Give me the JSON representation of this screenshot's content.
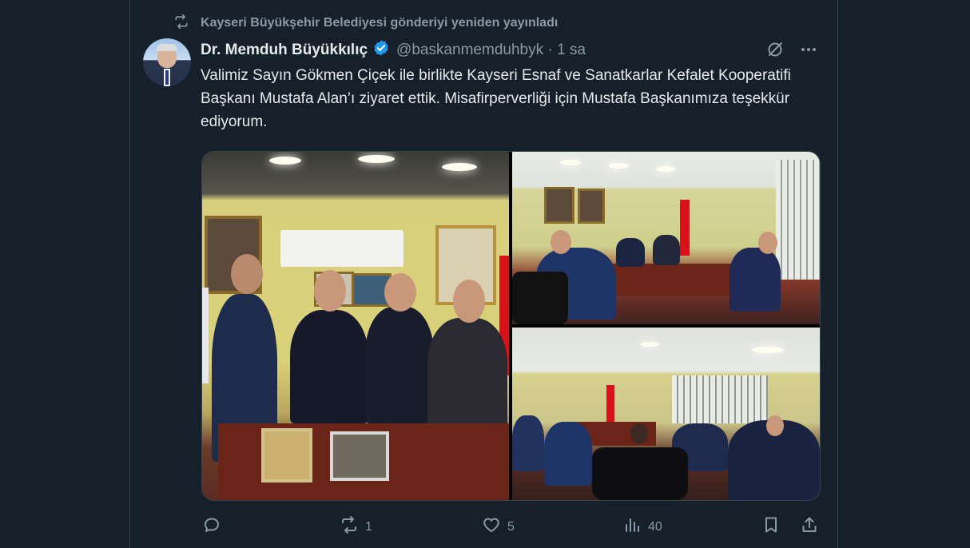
{
  "retweet": {
    "icon": "retweet-icon",
    "text": "Kayseri Büyükşehir Belediyesi gönderiyi yeniden yayınladı"
  },
  "author": {
    "name": "Dr. Memduh Büyükkılıç",
    "handle_time": "@baskanmemduhbyk · 1 sa",
    "verified_color": "#1d9bf0"
  },
  "tweet": {
    "text": "Valimiz Sayın Gökmen Çiçek ile birlikte Kayseri Esnaf ve Sanatkarlar Kefalet Kooperatifi Başkanı Mustafa Alan’ı ziyaret ettik. Misafirperverliği için Mustafa Başkanımıza teşekkür ediyorum."
  },
  "media": {
    "photos": [
      "group-photo",
      "meeting-photo-1",
      "meeting-photo-2"
    ]
  },
  "actions": {
    "reply": {
      "icon": "reply-icon",
      "count": ""
    },
    "retweet": {
      "icon": "retweet-icon",
      "count": "1"
    },
    "like": {
      "icon": "heart-icon",
      "count": "5"
    },
    "views": {
      "icon": "views-icon",
      "count": "40"
    },
    "bookmark": {
      "icon": "bookmark-icon"
    },
    "share": {
      "icon": "share-icon"
    }
  },
  "colors": {
    "background": "#15202b",
    "muted": "#8b98a5",
    "text": "#e7e9ea",
    "accent": "#1d9bf0"
  }
}
